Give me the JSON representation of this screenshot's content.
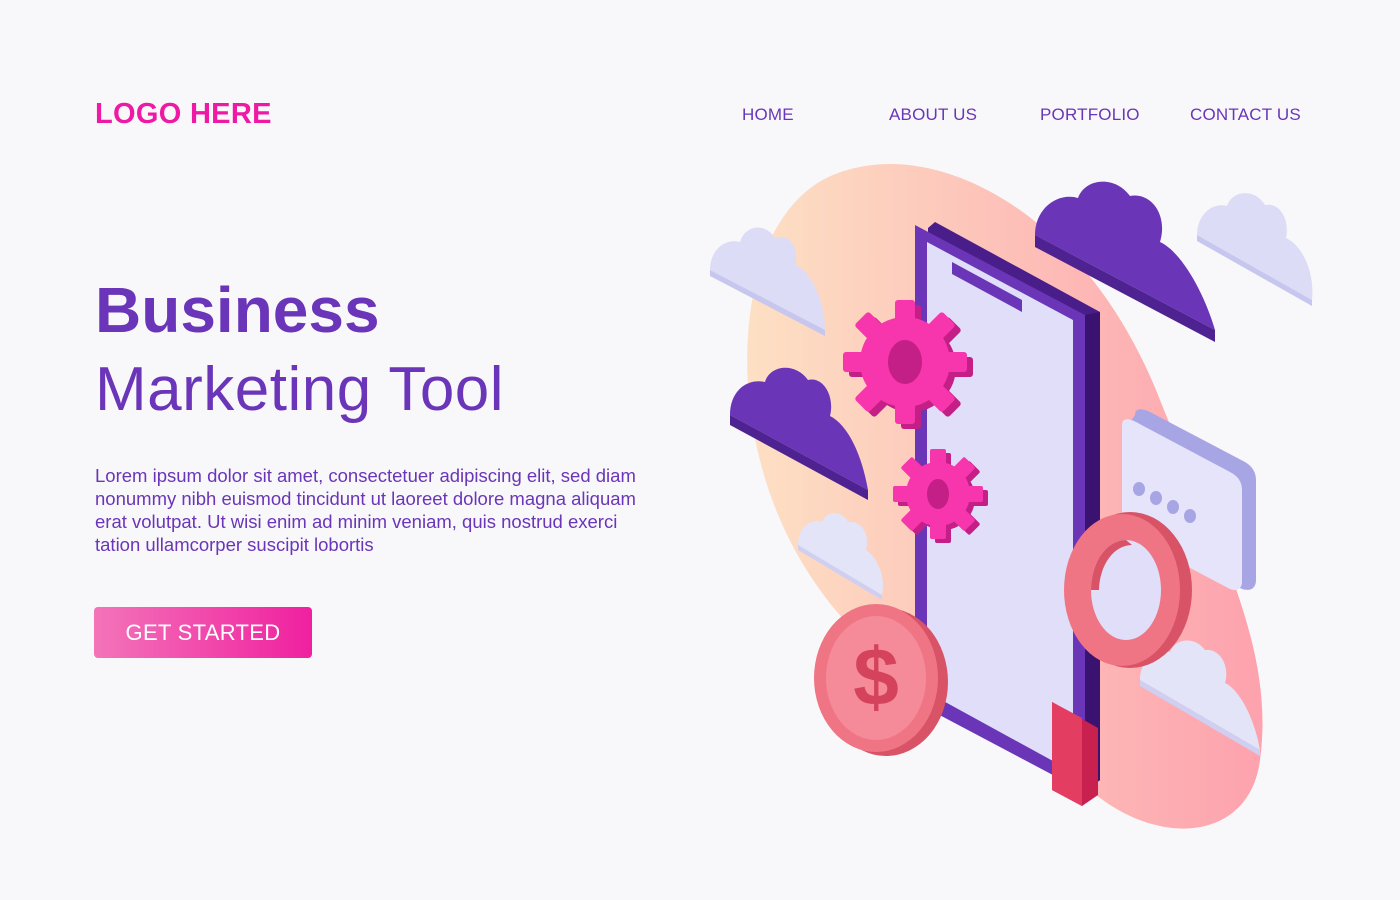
{
  "header": {
    "logo": "LOGO HERE",
    "nav": [
      {
        "label": "HOME"
      },
      {
        "label": "ABOUT US"
      },
      {
        "label": "PORTFOLIO"
      },
      {
        "label": "CONTACT US"
      }
    ]
  },
  "hero": {
    "title": "Business",
    "subtitle": "Marketing Tool",
    "body": "Lorem ipsum dolor sit amet, consectetuer adipiscing elit, sed diam nonummy nibh euismod tincidunt ut laoreet dolore magna aliquam erat volutpat. Ut wisi enim ad minim veniam, quis nostrud exerci tation ullamcorper suscipit lobortis",
    "cta_label": "GET STARTED"
  },
  "illustration": {
    "dollar_symbol": "$",
    "icons": [
      "smartphone-icon",
      "gear-icon",
      "chat-bubble-icon",
      "magnifier-icon",
      "dollar-coin-icon",
      "cloud-icon"
    ]
  },
  "colors": {
    "accent_pink": "#ee1aa5",
    "brand_purple": "#6a35b8",
    "background": "#f8f8fa"
  }
}
